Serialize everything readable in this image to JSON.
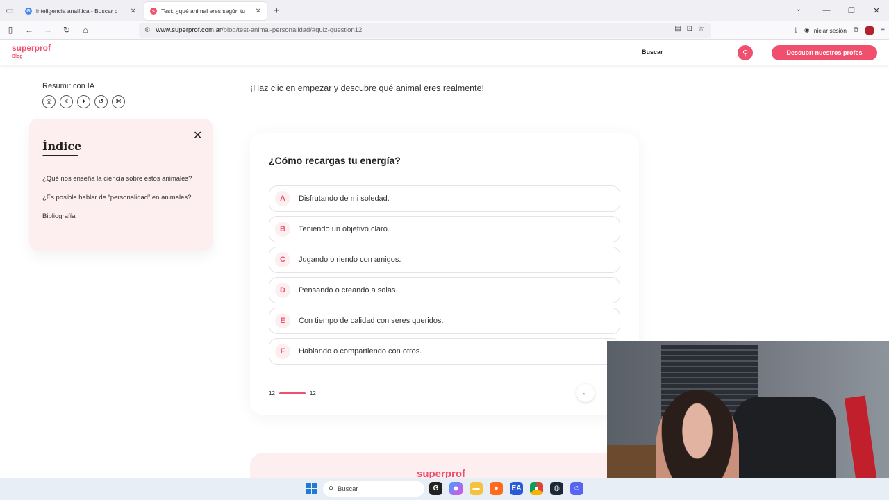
{
  "browser": {
    "tabs": [
      {
        "title": "inteligencia analítica - Buscar c",
        "favicon_color": "#4285f4",
        "active": false
      },
      {
        "title": "Test: ¿qué animal eres según tu",
        "favicon_color": "#f0506e",
        "active": true
      }
    ],
    "url_domain": "www.superprof.com.ar",
    "url_path": "/blog/test-animal-personalidad/#quiz-question12",
    "signin_label": "Iniciar sesión",
    "ext_badge_count": "3"
  },
  "site": {
    "logo": "superprof",
    "logo_sub": "Blog",
    "search_label": "Buscar",
    "cta_label": "Descubrí nuestros profes",
    "accent": "#f0506e"
  },
  "sidebar": {
    "resumir_label": "Resumir con IA",
    "ai_icons": [
      "chatgpt-icon",
      "claude-icon",
      "gemini-icon",
      "perplexity-icon",
      "grok-icon"
    ],
    "indice_title": "Índice",
    "indice_items": [
      "¿Qué nos enseña la ciencia sobre estos animales?",
      "¿Es posible hablar de “personalidad” en animales?",
      "Bibliografía"
    ]
  },
  "main": {
    "intro": "¡Haz clic en empezar y descubre qué animal eres realmente!",
    "question": "¿Cómo recargas tu energía?",
    "options": [
      {
        "letter": "A",
        "text": "Disfrutando de mi soledad."
      },
      {
        "letter": "B",
        "text": "Teniendo un objetivo claro."
      },
      {
        "letter": "C",
        "text": "Jugando o riendo con amigos."
      },
      {
        "letter": "D",
        "text": "Pensando o creando a solas."
      },
      {
        "letter": "E",
        "text": "Con tiempo de calidad con seres queridos."
      },
      {
        "letter": "F",
        "text": "Hablando o compartiendo con otros."
      }
    ],
    "progress_current": "12",
    "progress_total": "12",
    "progress_fraction": 1.0,
    "footer_logo": "superprof"
  },
  "taskbar": {
    "search_label": "Buscar",
    "apps": [
      "copilot-icon",
      "file-explorer-icon",
      "firefox-icon",
      "ea-icon",
      "chrome-icon",
      "steam-icon",
      "discord-icon"
    ]
  }
}
